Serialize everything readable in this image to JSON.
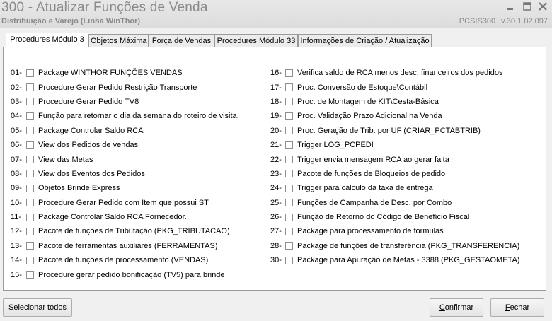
{
  "window": {
    "title": "300 - Atualizar Funções de Venda",
    "subtitle": "Distribuição e Varejo (Linha WinThor)",
    "program_code": "PCSIS300",
    "version": "v.30.1.02.097"
  },
  "tabs": [
    {
      "label": "Procedures Módulo 3",
      "active": true
    },
    {
      "label": "Objetos Máxima",
      "active": false
    },
    {
      "label": "Força de Vendas",
      "active": false
    },
    {
      "label": "Procedures Módulo 33",
      "active": false
    },
    {
      "label": "Informações de Criação / Atualização",
      "active": false
    }
  ],
  "items_left": [
    {
      "num": "01-",
      "label": "Package WINTHOR FUNÇÕES VENDAS",
      "checked": false
    },
    {
      "num": "02-",
      "label": "Procedure Gerar Pedido Restrição Transporte",
      "checked": false
    },
    {
      "num": "03-",
      "label": "Procedure Gerar Pedido TV8",
      "checked": false
    },
    {
      "num": "04-",
      "label": "Função para retornar o dia da semana do roteiro de visita.",
      "checked": false
    },
    {
      "num": "05-",
      "label": "Package Controlar Saldo RCA",
      "checked": false
    },
    {
      "num": "06-",
      "label": "View dos Pedidos de vendas",
      "checked": false
    },
    {
      "num": "07-",
      "label": "View das Metas",
      "checked": false
    },
    {
      "num": "08-",
      "label": "View dos Eventos dos Pedidos",
      "checked": false
    },
    {
      "num": "09-",
      "label": "Objetos Brinde Express",
      "checked": false
    },
    {
      "num": "10-",
      "label": "Procedure Gerar Pedido com Item que possui ST",
      "checked": false
    },
    {
      "num": "11-",
      "label": "Package Controlar Saldo RCA Fornecedor.",
      "checked": false
    },
    {
      "num": "12-",
      "label": "Pacote de funções de Tributação (PKG_TRIBUTACAO)",
      "checked": false
    },
    {
      "num": "13-",
      "label": "Pacote de ferramentas auxiliares (FERRAMENTAS)",
      "checked": false
    },
    {
      "num": "14-",
      "label": "Pacote de funções de processamento (VENDAS)",
      "checked": false
    },
    {
      "num": "15-",
      "label": "Procedure gerar pedido bonificação (TV5) para brinde",
      "checked": false
    }
  ],
  "items_right": [
    {
      "num": "16-",
      "label": "Verifica saldo de RCA menos desc. financeiros dos pedidos",
      "checked": false
    },
    {
      "num": "17-",
      "label": "Proc. Conversão de Estoque\\Contábil",
      "checked": false
    },
    {
      "num": "18-",
      "label": "Proc. de Montagem de KIT\\Cesta-Básica",
      "checked": false
    },
    {
      "num": "19-",
      "label": "Proc. Validação Prazo Adicional na Venda",
      "checked": false
    },
    {
      "num": "20-",
      "label": "Proc. Geração de Trib. por UF (CRIAR_PCTABTRIB)",
      "checked": false
    },
    {
      "num": "21-",
      "label": "Trigger LOG_PCPEDI",
      "checked": false
    },
    {
      "num": "22-",
      "label": "Trigger envia mensagem RCA ao gerar falta",
      "checked": false
    },
    {
      "num": "23-",
      "label": "Pacote de funções de Bloqueios de pedido",
      "checked": false
    },
    {
      "num": "24-",
      "label": "Trigger para cálculo da taxa de entrega",
      "checked": false
    },
    {
      "num": "25-",
      "label": "Funções de Campanha de Desc. por Combo",
      "checked": false
    },
    {
      "num": "26-",
      "label": "Função de Retorno do Código de Benefício Fiscal",
      "checked": false
    },
    {
      "num": "27-",
      "label": "Package para processamento de fórmulas",
      "checked": false
    },
    {
      "num": "28-",
      "label": "Package de funções de transferência (PKG_TRANSFERENCIA)",
      "checked": false
    },
    {
      "num": "30-",
      "label": "Package para Apuração de Metas - 3388 (PKG_GESTAOMETA)",
      "checked": false
    }
  ],
  "buttons": {
    "select_all": "Selecionar todos",
    "confirm_first": "C",
    "confirm_rest": "onfirmar",
    "close_first": "F",
    "close_rest": "echar"
  },
  "icons": {
    "minimize": "minimize-icon",
    "maximize": "maximize-icon",
    "close": "close-icon"
  }
}
